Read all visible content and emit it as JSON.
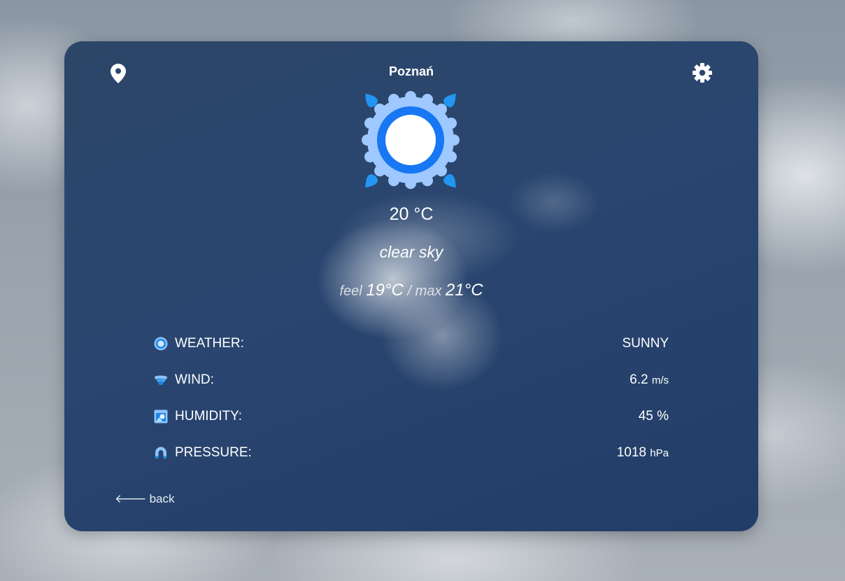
{
  "header": {
    "city": "Poznań",
    "location_icon": "map-pin-icon",
    "settings_icon": "gear-icon"
  },
  "current": {
    "icon": "sun-icon",
    "temperature": "20 °C",
    "description": "clear sky",
    "feel_label": "feel",
    "feel_value": "19°C",
    "separator": "/",
    "max_label": "max",
    "max_value": "21°C"
  },
  "details": [
    {
      "icon": "sun-small-icon",
      "label": "WEATHER:",
      "value": "SUNNY",
      "unit": ""
    },
    {
      "icon": "wind-icon",
      "label": "WIND:",
      "value": "6.2",
      "unit": "m/s"
    },
    {
      "icon": "humidity-icon",
      "label": "HUMIDITY:",
      "value": "45 %",
      "unit": ""
    },
    {
      "icon": "magnet-icon",
      "label": "PRESSURE:",
      "value": "1018",
      "unit": "hPa"
    }
  ],
  "footer": {
    "back_label": "back",
    "back_icon": "arrow-left-icon"
  },
  "colors": {
    "card_background": "#2a4670",
    "sun_ring": "#1877f2",
    "sun_halo": "#9ec8ff",
    "sun_drops": "#2196f3",
    "text": "#ffffff"
  }
}
